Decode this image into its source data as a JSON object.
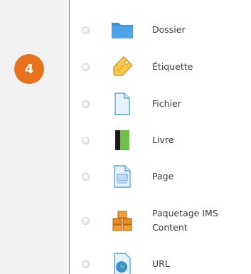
{
  "step_badge": "4",
  "modules": [
    {
      "label": "Dossier",
      "icon": "folder-icon"
    },
    {
      "label": "Étiquette",
      "icon": "label-tag-icon"
    },
    {
      "label": "Fichier",
      "icon": "file-icon"
    },
    {
      "label": "Livre",
      "icon": "book-icon"
    },
    {
      "label": "Page",
      "icon": "page-icon"
    },
    {
      "label": "Paquetage IMS Content",
      "icon": "ims-package-icon"
    },
    {
      "label": "URL",
      "icon": "url-globe-icon"
    }
  ]
}
